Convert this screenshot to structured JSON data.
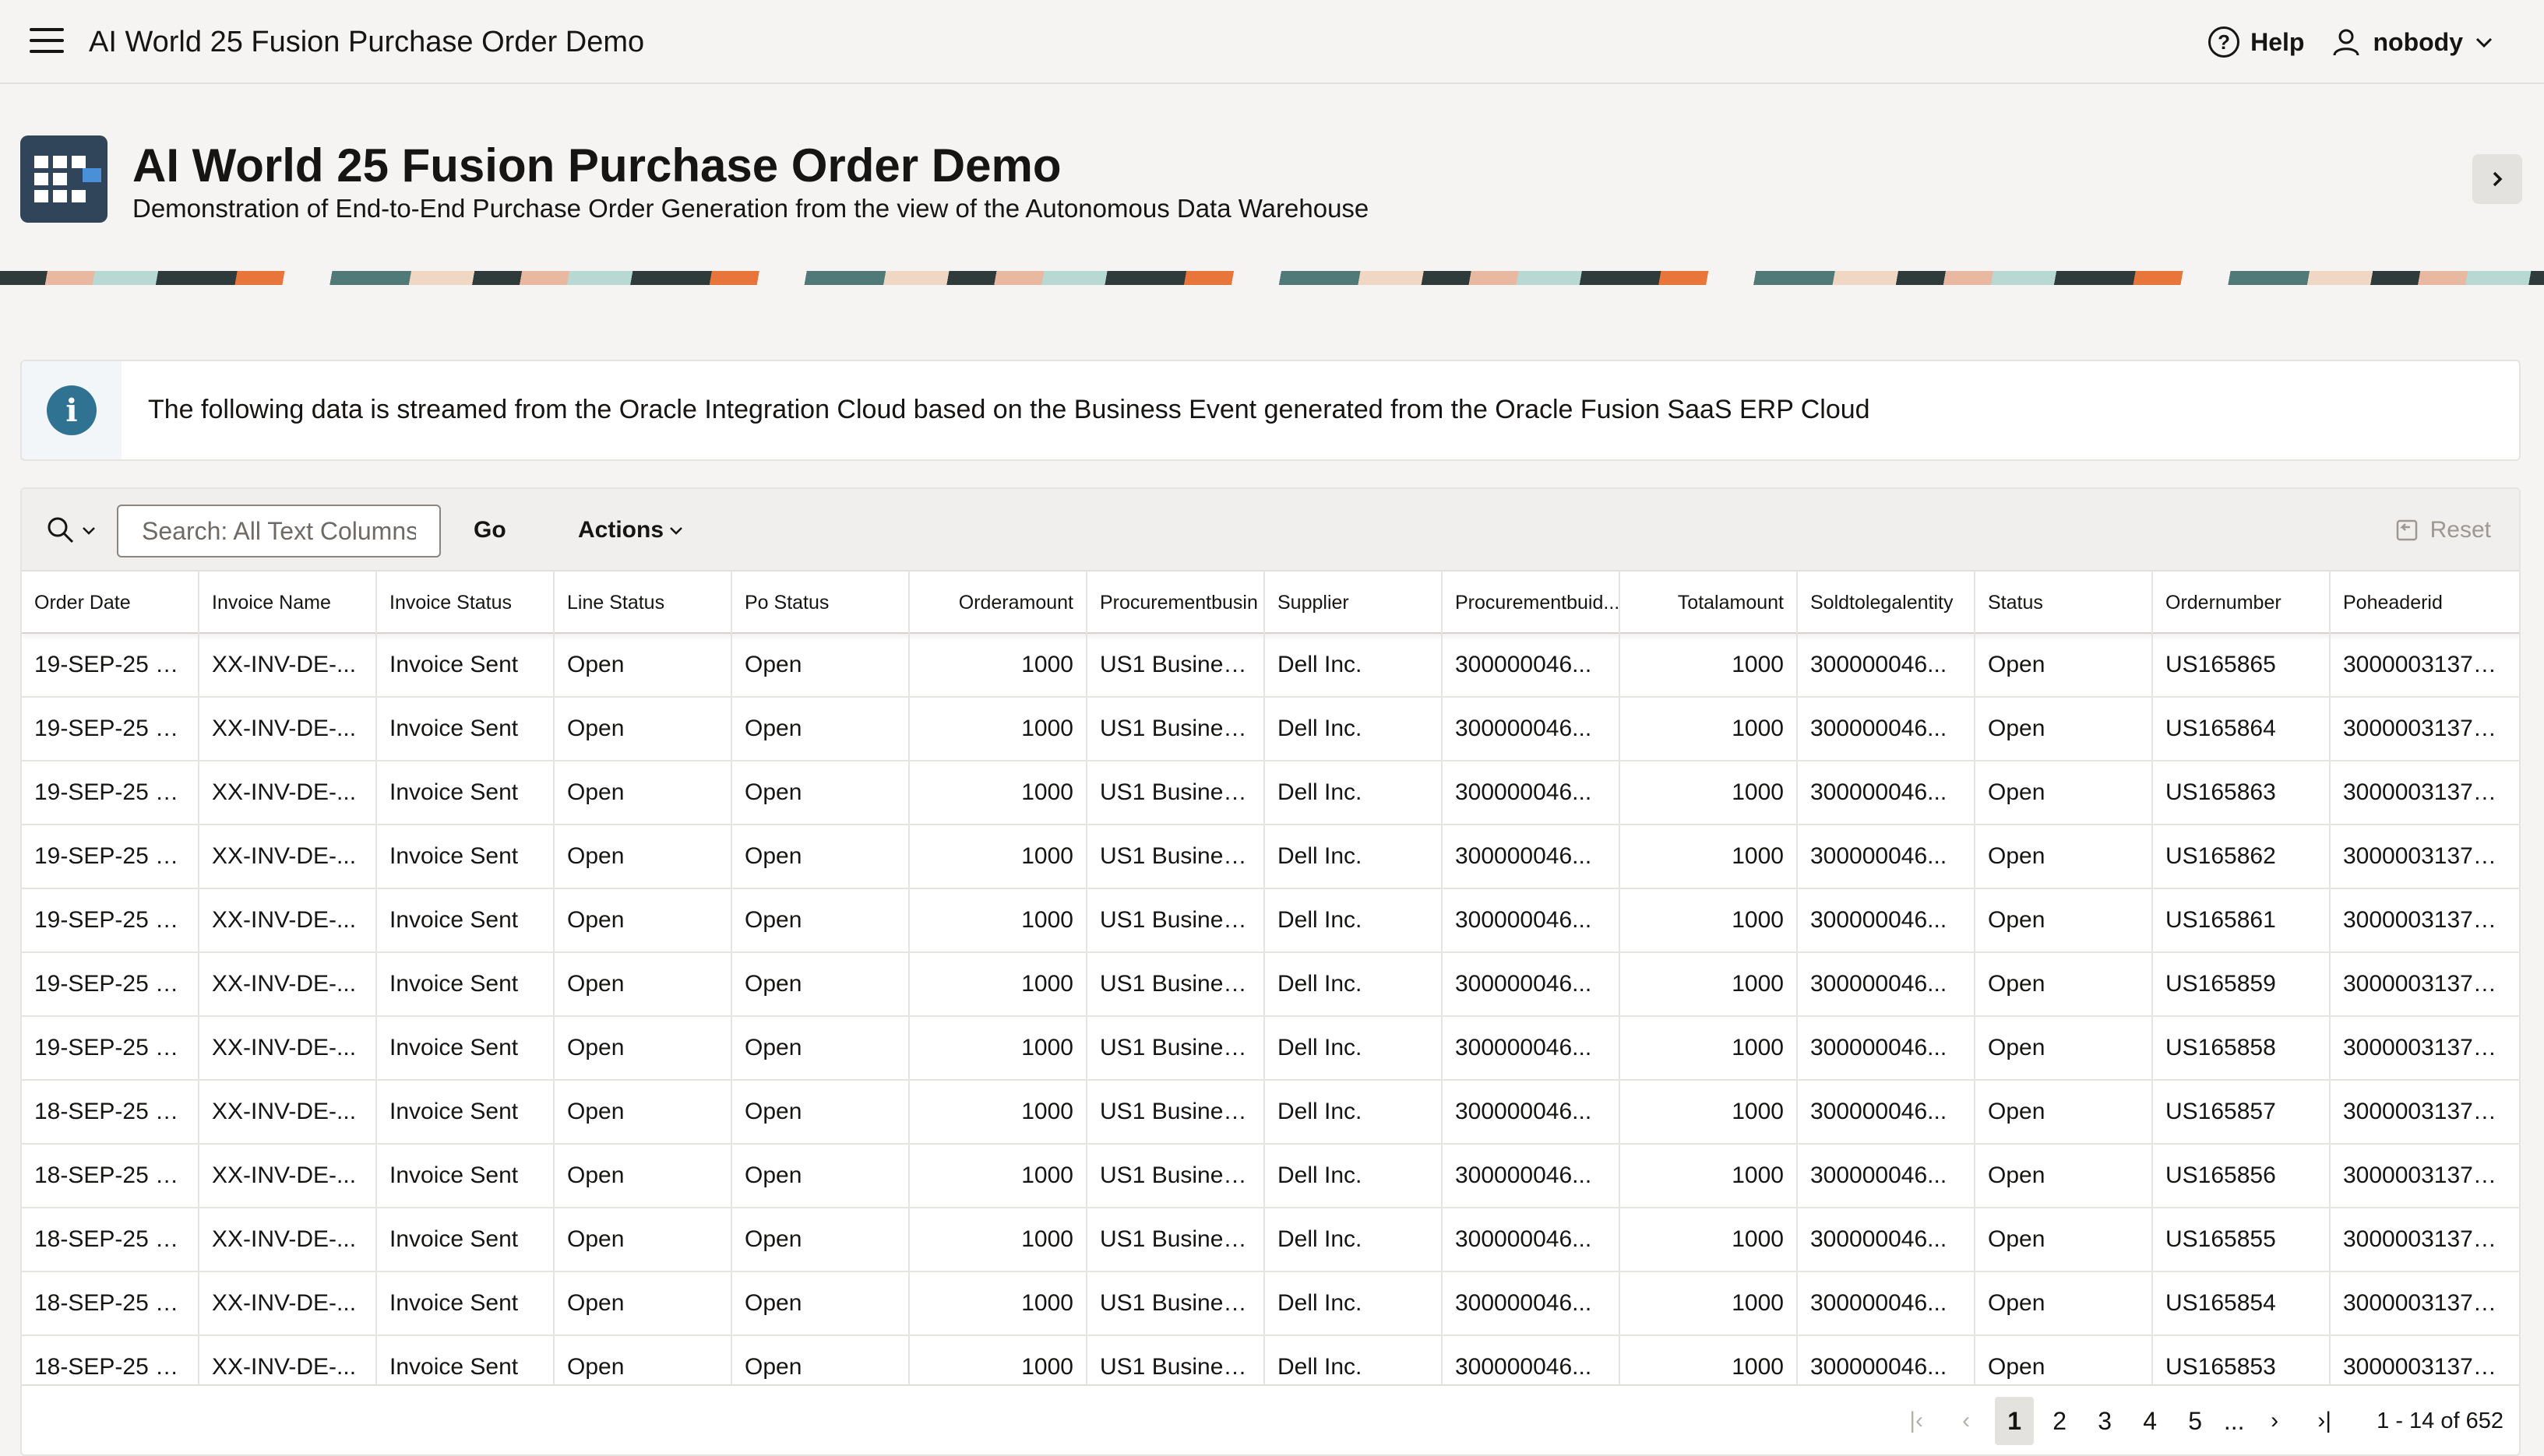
{
  "app": {
    "title": "AI World 25 Fusion Purchase Order Demo",
    "help_label": "Help",
    "user_label": "nobody"
  },
  "hero": {
    "title": "AI World 25 Fusion Purchase Order Demo",
    "subtitle": "Demonstration of End-to-End Purchase Order Generation from the view of the Autonomous Data Warehouse"
  },
  "alert": {
    "icon": "info-icon",
    "text": "The following data is streamed from the Oracle Integration Cloud based on the Business Event generated from the Oracle Fusion SaaS ERP Cloud"
  },
  "toolbar": {
    "search_placeholder": "Search: All Text Columns",
    "go_label": "Go",
    "actions_label": "Actions",
    "reset_label": "Reset"
  },
  "grid": {
    "columns": [
      "Order Date",
      "Invoice Name",
      "Invoice Status",
      "Line Status",
      "Po Status",
      "Orderamount",
      "Procurementbusin",
      "Supplier",
      "Procurementbuid...",
      "Totalamount",
      "Soldtolegalentity",
      "Status",
      "Ordernumber",
      "Poheaderid"
    ],
    "rows": [
      [
        "19-SEP-25 01...",
        "XX-INV-DE-...",
        "Invoice Sent",
        "Open",
        "Open",
        "1000",
        "US1 Business...",
        "Dell Inc.",
        "300000046...",
        "1000",
        "300000046...",
        "Open",
        "US165865",
        "300000313778..."
      ],
      [
        "19-SEP-25 01...",
        "XX-INV-DE-...",
        "Invoice Sent",
        "Open",
        "Open",
        "1000",
        "US1 Business...",
        "Dell Inc.",
        "300000046...",
        "1000",
        "300000046...",
        "Open",
        "US165864",
        "300000313778..."
      ],
      [
        "19-SEP-25 12...",
        "XX-INV-DE-...",
        "Invoice Sent",
        "Open",
        "Open",
        "1000",
        "US1 Business...",
        "Dell Inc.",
        "300000046...",
        "1000",
        "300000046...",
        "Open",
        "US165863",
        "300000313778..."
      ],
      [
        "19-SEP-25 12...",
        "XX-INV-DE-...",
        "Invoice Sent",
        "Open",
        "Open",
        "1000",
        "US1 Business...",
        "Dell Inc.",
        "300000046...",
        "1000",
        "300000046...",
        "Open",
        "US165862",
        "300000313778..."
      ],
      [
        "19-SEP-25 12...",
        "XX-INV-DE-...",
        "Invoice Sent",
        "Open",
        "Open",
        "1000",
        "US1 Business...",
        "Dell Inc.",
        "300000046...",
        "1000",
        "300000046...",
        "Open",
        "US165861",
        "300000313778..."
      ],
      [
        "19-SEP-25 12....",
        "XX-INV-DE-...",
        "Invoice Sent",
        "Open",
        "Open",
        "1000",
        "US1 Business...",
        "Dell Inc.",
        "300000046...",
        "1000",
        "300000046...",
        "Open",
        "US165859",
        "300000313778..."
      ],
      [
        "19-SEP-25 12...",
        "XX-INV-DE-...",
        "Invoice Sent",
        "Open",
        "Open",
        "1000",
        "US1 Business...",
        "Dell Inc.",
        "300000046...",
        "1000",
        "300000046...",
        "Open",
        "US165858",
        "300000313778..."
      ],
      [
        "18-SEP-25 11....",
        "XX-INV-DE-...",
        "Invoice Sent",
        "Open",
        "Open",
        "1000",
        "US1 Business...",
        "Dell Inc.",
        "300000046...",
        "1000",
        "300000046...",
        "Open",
        "US165857",
        "300000313778..."
      ],
      [
        "18-SEP-25 11....",
        "XX-INV-DE-...",
        "Invoice Sent",
        "Open",
        "Open",
        "1000",
        "US1 Business...",
        "Dell Inc.",
        "300000046...",
        "1000",
        "300000046...",
        "Open",
        "US165856",
        "300000313778..."
      ],
      [
        "18-SEP-25 11....",
        "XX-INV-DE-...",
        "Invoice Sent",
        "Open",
        "Open",
        "1000",
        "US1 Business...",
        "Dell Inc.",
        "300000046...",
        "1000",
        "300000046...",
        "Open",
        "US165855",
        "300000313778..."
      ],
      [
        "18-SEP-25 11....",
        "XX-INV-DE-...",
        "Invoice Sent",
        "Open",
        "Open",
        "1000",
        "US1 Business...",
        "Dell Inc.",
        "300000046...",
        "1000",
        "300000046...",
        "Open",
        "US165854",
        "300000313778..."
      ],
      [
        "18-SEP-25 11....",
        "XX-INV-DE-...",
        "Invoice Sent",
        "Open",
        "Open",
        "1000",
        "US1 Business...",
        "Dell Inc.",
        "300000046...",
        "1000",
        "300000046...",
        "Open",
        "US165853",
        "300000313778..."
      ]
    ]
  },
  "pagination": {
    "pages": [
      "1",
      "2",
      "3",
      "4",
      "5"
    ],
    "current_page": "1",
    "ellipsis": "...",
    "range_text": "1 - 14 of 652"
  },
  "colors": {
    "accent_dark": "#30445a",
    "info": "#307292",
    "page_bg": "#f5f4f2"
  }
}
